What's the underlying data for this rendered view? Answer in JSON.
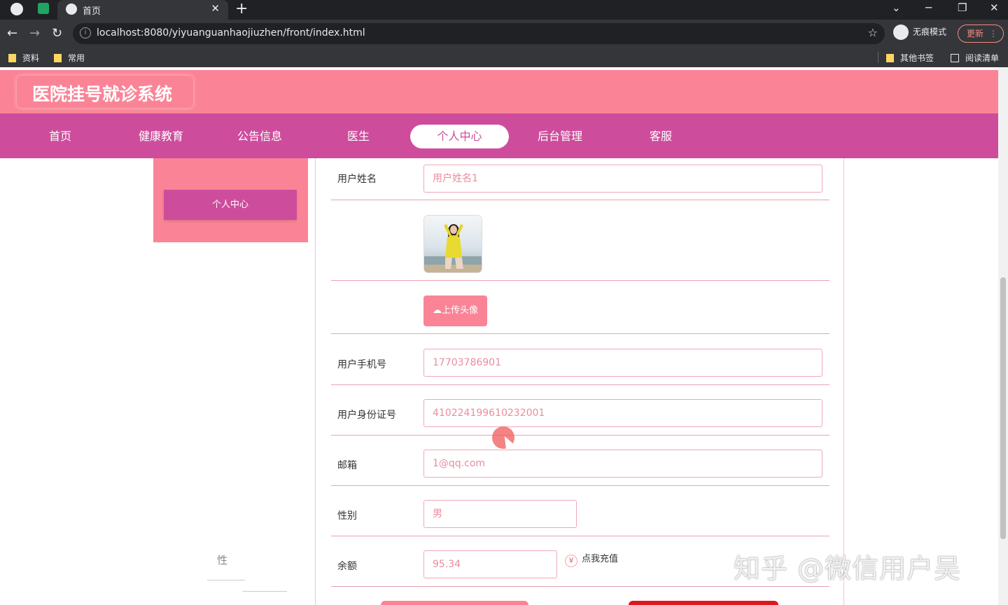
{
  "browser": {
    "tab_title": "首页",
    "url": "localhost:8080/yiyuanguanhaojiuzhen/front/index.html",
    "incognito_label": "无痕模式",
    "update_label": "更新",
    "bookmarks": [
      "资料",
      "常用"
    ],
    "bookmarks_right": [
      "其他书签",
      "阅读清单"
    ]
  },
  "site": {
    "title": "医院挂号就诊系统"
  },
  "nav": {
    "items": [
      {
        "label": "首页",
        "active": false
      },
      {
        "label": "健康教育",
        "active": false
      },
      {
        "label": "公告信息",
        "active": false
      },
      {
        "label": "医生",
        "active": false
      },
      {
        "label": "个人中心",
        "active": true
      },
      {
        "label": "后台管理",
        "active": false
      },
      {
        "label": "客服",
        "active": false
      }
    ]
  },
  "sidebar": {
    "button_label": "个人中心"
  },
  "form": {
    "username_label": "用户姓名",
    "username_placeholder": "用户姓名1",
    "upload_label": "上传头像",
    "phone_label": "用户手机号",
    "phone_value": "17703786901",
    "idcard_label": "用户身份证号",
    "idcard_value": "410224199610232001",
    "email_label": "邮箱",
    "email_value": "1@qq.com",
    "gender_label": "性别",
    "gender_value": "男",
    "balance_label": "余额",
    "balance_value": "95.34",
    "recharge_label": "点我充值",
    "yen_symbol": "¥"
  },
  "overlay": {
    "blur_text": "性",
    "watermark": "知乎 @微信用户吴"
  },
  "colors": {
    "header_pink": "#fa8496",
    "nav_magenta": "#cd4d9c",
    "input_text": "#e98da0"
  }
}
